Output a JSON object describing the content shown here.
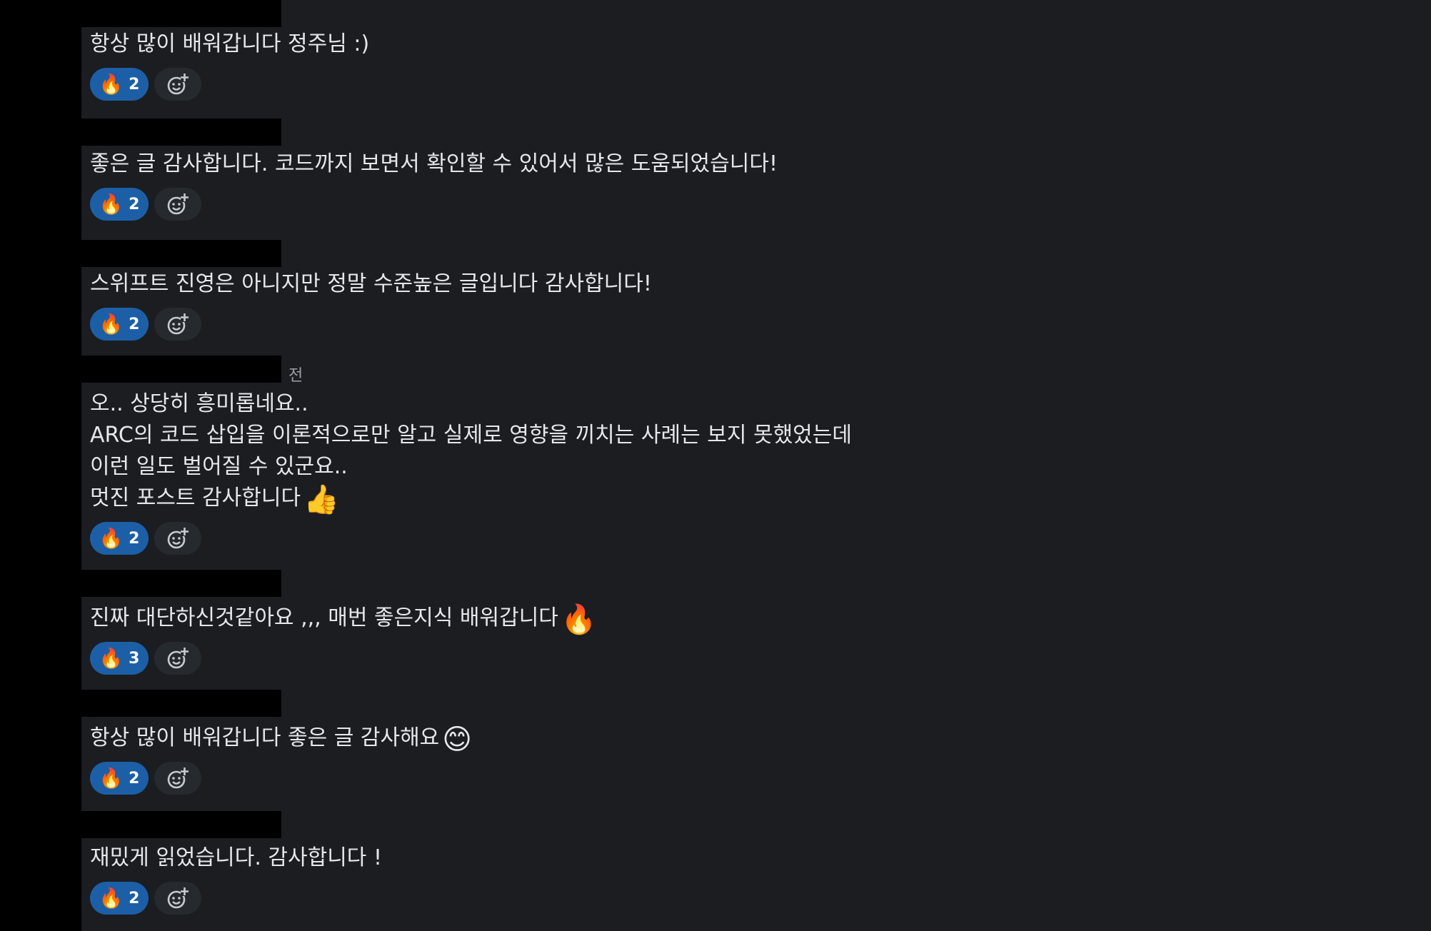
{
  "comments": [
    {
      "text": "항상 많이 배워갑니다 정주님 :)",
      "emoji": "",
      "reaction": {
        "emoji": "🔥",
        "count": "2"
      }
    },
    {
      "text": "좋은 글 감사합니다. 코드까지 보면서 확인할 수 있어서 많은 도움되었습니다!",
      "emoji": "",
      "reaction": {
        "emoji": "🔥",
        "count": "2"
      }
    },
    {
      "text": "스위프트 진영은 아니지만 정말 수준높은 글입니다 감사합니다!",
      "emoji": "",
      "reaction": {
        "emoji": "🔥",
        "count": "2"
      }
    },
    {
      "text": "오.. 상당히 흥미롭네요..\nARC의 코드 삽입을 이론적으로만 알고 실제로 영향을 끼치는 사례는 보지 못했었는데\n이런 일도 벌어질 수 있군요..\n멋진 포스트 감사합니다",
      "emoji": "👍",
      "reaction": {
        "emoji": "🔥",
        "count": "2"
      }
    },
    {
      "text": "진짜 대단하신것같아요 ,,, 매번 좋은지식 배워갑니다",
      "emoji": "🔥",
      "reaction": {
        "emoji": "🔥",
        "count": "3"
      }
    },
    {
      "text": "항상 많이 배워갑니다 좋은 글 감사해요",
      "emoji": "😊",
      "reaction": {
        "emoji": "🔥",
        "count": "2"
      }
    },
    {
      "text": "재밌게 읽었습니다. 감사합니다 !",
      "emoji": "",
      "reaction": {
        "emoji": "🔥",
        "count": "2"
      }
    }
  ],
  "timestamp_suffix": "전",
  "icons": {
    "add_reaction": "add-reaction-icon"
  },
  "colors": {
    "background": "#1b1d21",
    "reaction_pill": "#1c5fa6",
    "add_reaction_bg": "#26292e",
    "text": "#e6e7e9",
    "redaction": "#000000"
  }
}
